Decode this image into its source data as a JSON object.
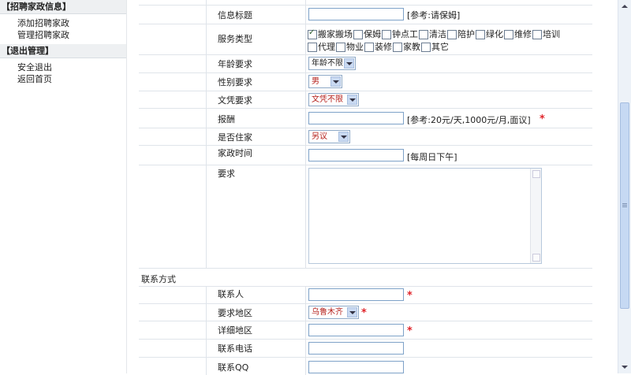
{
  "sidebar": {
    "group1": "【招聘家政信息】",
    "group1_items": [
      "添加招聘家政",
      "管理招聘家政"
    ],
    "group2": "【退出管理】",
    "group2_items": [
      "安全退出",
      "返回首页"
    ]
  },
  "form": {
    "title_label": "信息标题",
    "title_value": "",
    "title_hint": "[参考:请保姆]",
    "service_label": "服务类型",
    "service_options_line1": [
      {
        "label": "搬家搬场",
        "checked": true
      },
      {
        "label": "保姆",
        "checked": false
      },
      {
        "label": "钟点工",
        "checked": false
      },
      {
        "label": "清洁",
        "checked": false
      },
      {
        "label": "陪护",
        "checked": false
      },
      {
        "label": "绿化",
        "checked": false
      },
      {
        "label": "维修",
        "checked": false
      },
      {
        "label": "培训",
        "checked": false
      }
    ],
    "service_options_line2": [
      {
        "label": "代理",
        "checked": false
      },
      {
        "label": "物业",
        "checked": false
      },
      {
        "label": "装修",
        "checked": false
      },
      {
        "label": "家教",
        "checked": false
      },
      {
        "label": "其它",
        "checked": false
      }
    ],
    "age_label": "年龄要求",
    "age_value": "年龄不限",
    "gender_label": "性别要求",
    "gender_value": "男",
    "edu_label": "文凭要求",
    "edu_value": "文凭不限",
    "pay_label": "报酬",
    "pay_value": "",
    "pay_hint": "[参考:20元/天,1000元/月,面议]",
    "live_label": "是否住家",
    "live_value": "另议",
    "time_label": "家政时间",
    "time_value": "",
    "time_hint": "[每周日下午]",
    "req_label": "要求",
    "req_value": "",
    "contact_section": "联系方式",
    "contact_person_label": "联系人",
    "contact_person_value": "",
    "region_label": "要求地区",
    "region_value": "乌鲁木齐",
    "address_label": "详细地区",
    "address_value": "",
    "phone_label": "联系电话",
    "phone_value": "",
    "qq_label": "联系QQ",
    "qq_value": "",
    "required_mark": "*"
  }
}
